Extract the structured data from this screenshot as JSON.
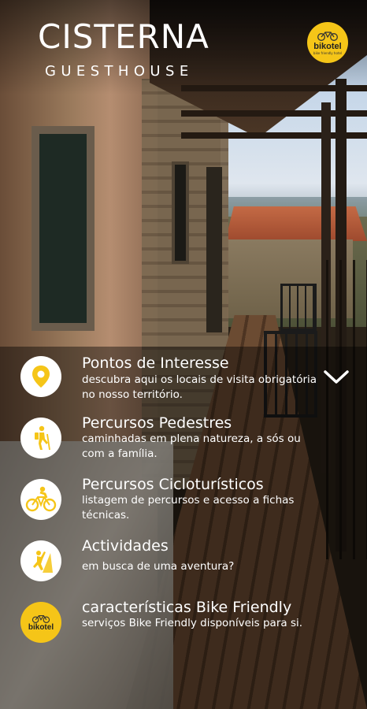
{
  "header": {
    "title": "CISTERNA",
    "subtitle": "GUESTHOUSE",
    "logo_text": "bikotel",
    "logo_sub": "bike friendly hotel"
  },
  "menu": {
    "items": [
      {
        "icon": "map-pin-icon",
        "title": "Pontos de Interesse",
        "desc": "descubra aqui os locais de visita obrigatória no nosso território."
      },
      {
        "icon": "hiker-icon",
        "title": "Percursos Pedestres",
        "desc": "caminhadas em plena natureza, a sós ou com a família."
      },
      {
        "icon": "cyclist-icon",
        "title": "Percursos Cicloturísticos",
        "desc": "listagem de percursos e acesso a fichas técnicas."
      },
      {
        "icon": "climber-icon",
        "title": "Actividades",
        "desc": "em busca de uma aventura?"
      },
      {
        "icon": "bikotel-icon",
        "title": "características Bike Friendly",
        "desc": "serviços Bike Friendly disponíveis para si."
      }
    ],
    "expand_icon": "chevron-down-icon"
  },
  "colors": {
    "accent": "#f5c518",
    "icon_bg": "#ffffff",
    "text": "#ffffff"
  }
}
